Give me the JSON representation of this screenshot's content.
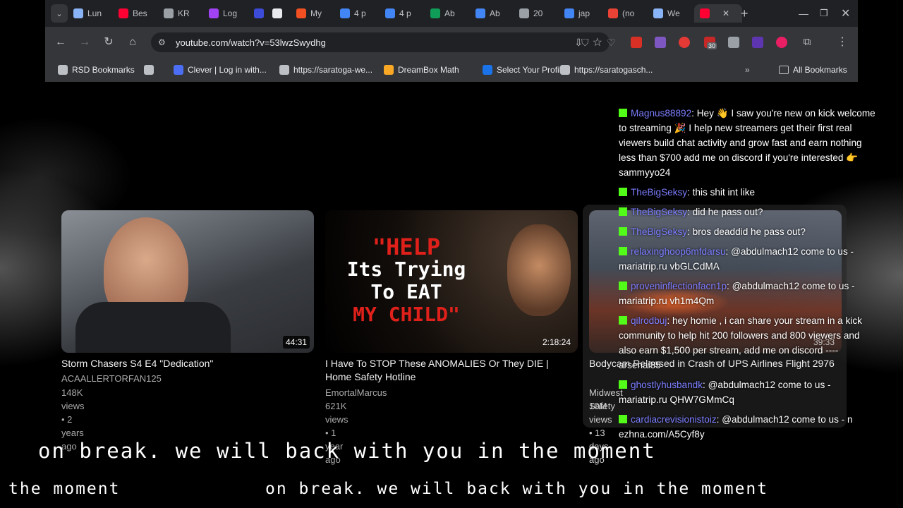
{
  "browser": {
    "tabs": [
      {
        "label": "Lun",
        "color": "#8ab4f8"
      },
      {
        "label": "Bes",
        "color": "#ff0033"
      },
      {
        "label": "KR",
        "color": "#9aa0a6"
      },
      {
        "label": "Log",
        "color": "#a142f4"
      },
      {
        "label": "",
        "color": "#3c4bd8"
      },
      {
        "label": "",
        "color": "#e8eaed"
      },
      {
        "label": "My",
        "color": "#f25022"
      },
      {
        "label": "4 p",
        "color": "#4285f4"
      },
      {
        "label": "4 p",
        "color": "#4285f4"
      },
      {
        "label": "Ab",
        "color": "#0f9d58"
      },
      {
        "label": "Ab",
        "color": "#4285f4"
      },
      {
        "label": "20",
        "color": "#9aa0a6"
      },
      {
        "label": "jap",
        "color": "#4285f4"
      },
      {
        "label": "(no",
        "color": "#ea4335"
      },
      {
        "label": "We",
        "color": "#8ab4f8"
      },
      {
        "label": "",
        "color": "#ff0033"
      }
    ],
    "url": "youtube.com/watch?v=53lwzSwydhg",
    "extension_badge": "30",
    "bookmarks": [
      {
        "label": "RSD Bookmarks",
        "icon": "folder-icon"
      },
      {
        "label": "",
        "icon": "apps-icon"
      },
      {
        "label": "Clever | Log in with...",
        "icon": "clever-icon"
      },
      {
        "label": "https://saratoga-we...",
        "icon": "globe-icon"
      },
      {
        "label": "DreamBox Math",
        "icon": "dreambox-icon"
      },
      {
        "label": "Select Your Profile",
        "icon": "profile-icon"
      },
      {
        "label": "https://saratogasch...",
        "icon": "link-icon"
      }
    ],
    "all_bookmarks": "All Bookmarks"
  },
  "videos": [
    {
      "title": "Storm Chasers S4 E4 \"Dedication\"",
      "channel": "ACAALLERTORFAN125",
      "meta": "148K views • 2 years ago",
      "duration": "44:31"
    },
    {
      "title": "I Have To STOP These ANOMALIES Or They DIE | Home Safety Hotline",
      "channel": "EmortalMarcus",
      "meta": "621K views • 1 year ago",
      "duration": "2:18:24",
      "thumb_line1": "\"HELP",
      "thumb_line2": "Its Trying",
      "thumb_line3": "To EAT",
      "thumb_line4": "MY CHILD\""
    },
    {
      "title": "Bodycam Released in Crash of UPS Airlines Flight 2976",
      "channel": "Midwest Safety",
      "meta": "10M views • 13 days ago",
      "duration": "39:33"
    }
  ],
  "chat": [
    {
      "user": "Magnus88892",
      "text": "Hey 👋 I saw you're new on kick welcome to streaming 🎉 I help new streamers get their first real viewers build chat activity and grow fast and earn nothing less than $700 add me on discord if you're interested 👉 sammyyo24"
    },
    {
      "user": "TheBigSeksy",
      "text": "this shit int like"
    },
    {
      "user": "TheBigSeksy",
      "text": "did he pass out?"
    },
    {
      "user": "TheBigSeksy",
      "text": "bros deaddid he pass out?"
    },
    {
      "user": "relaxinghoop6mfdarsu",
      "text": "@abdulmach12 come to us - mariatrip.ru vbGLCdMA"
    },
    {
      "user": "proveninflectionfacn1p",
      "text": "@abdulmach12 come to us - mariatrip.ru vh1m4Qm"
    },
    {
      "user": "qilrodbuj",
      "text": "hey homie , i can share your stream in a kick community to help hit 200 followers and 800 viewers and also earn $1,500 per stream, add me on discord ---- arsenai85"
    },
    {
      "user": "ghostlyhusbandk",
      "text": "@abdulmach12 come to us - mariatrip.ru QHW7GMmCq"
    },
    {
      "user": "cardiacrevisionistoiz",
      "text": "@abdulmach12 come to us - n ezhna.com/A5Cyf8y"
    }
  ],
  "ticker": {
    "line1": "on break. we will back with you in the moment",
    "line2_left": "the moment",
    "line2_right": "on break. we will back with you in the moment"
  }
}
